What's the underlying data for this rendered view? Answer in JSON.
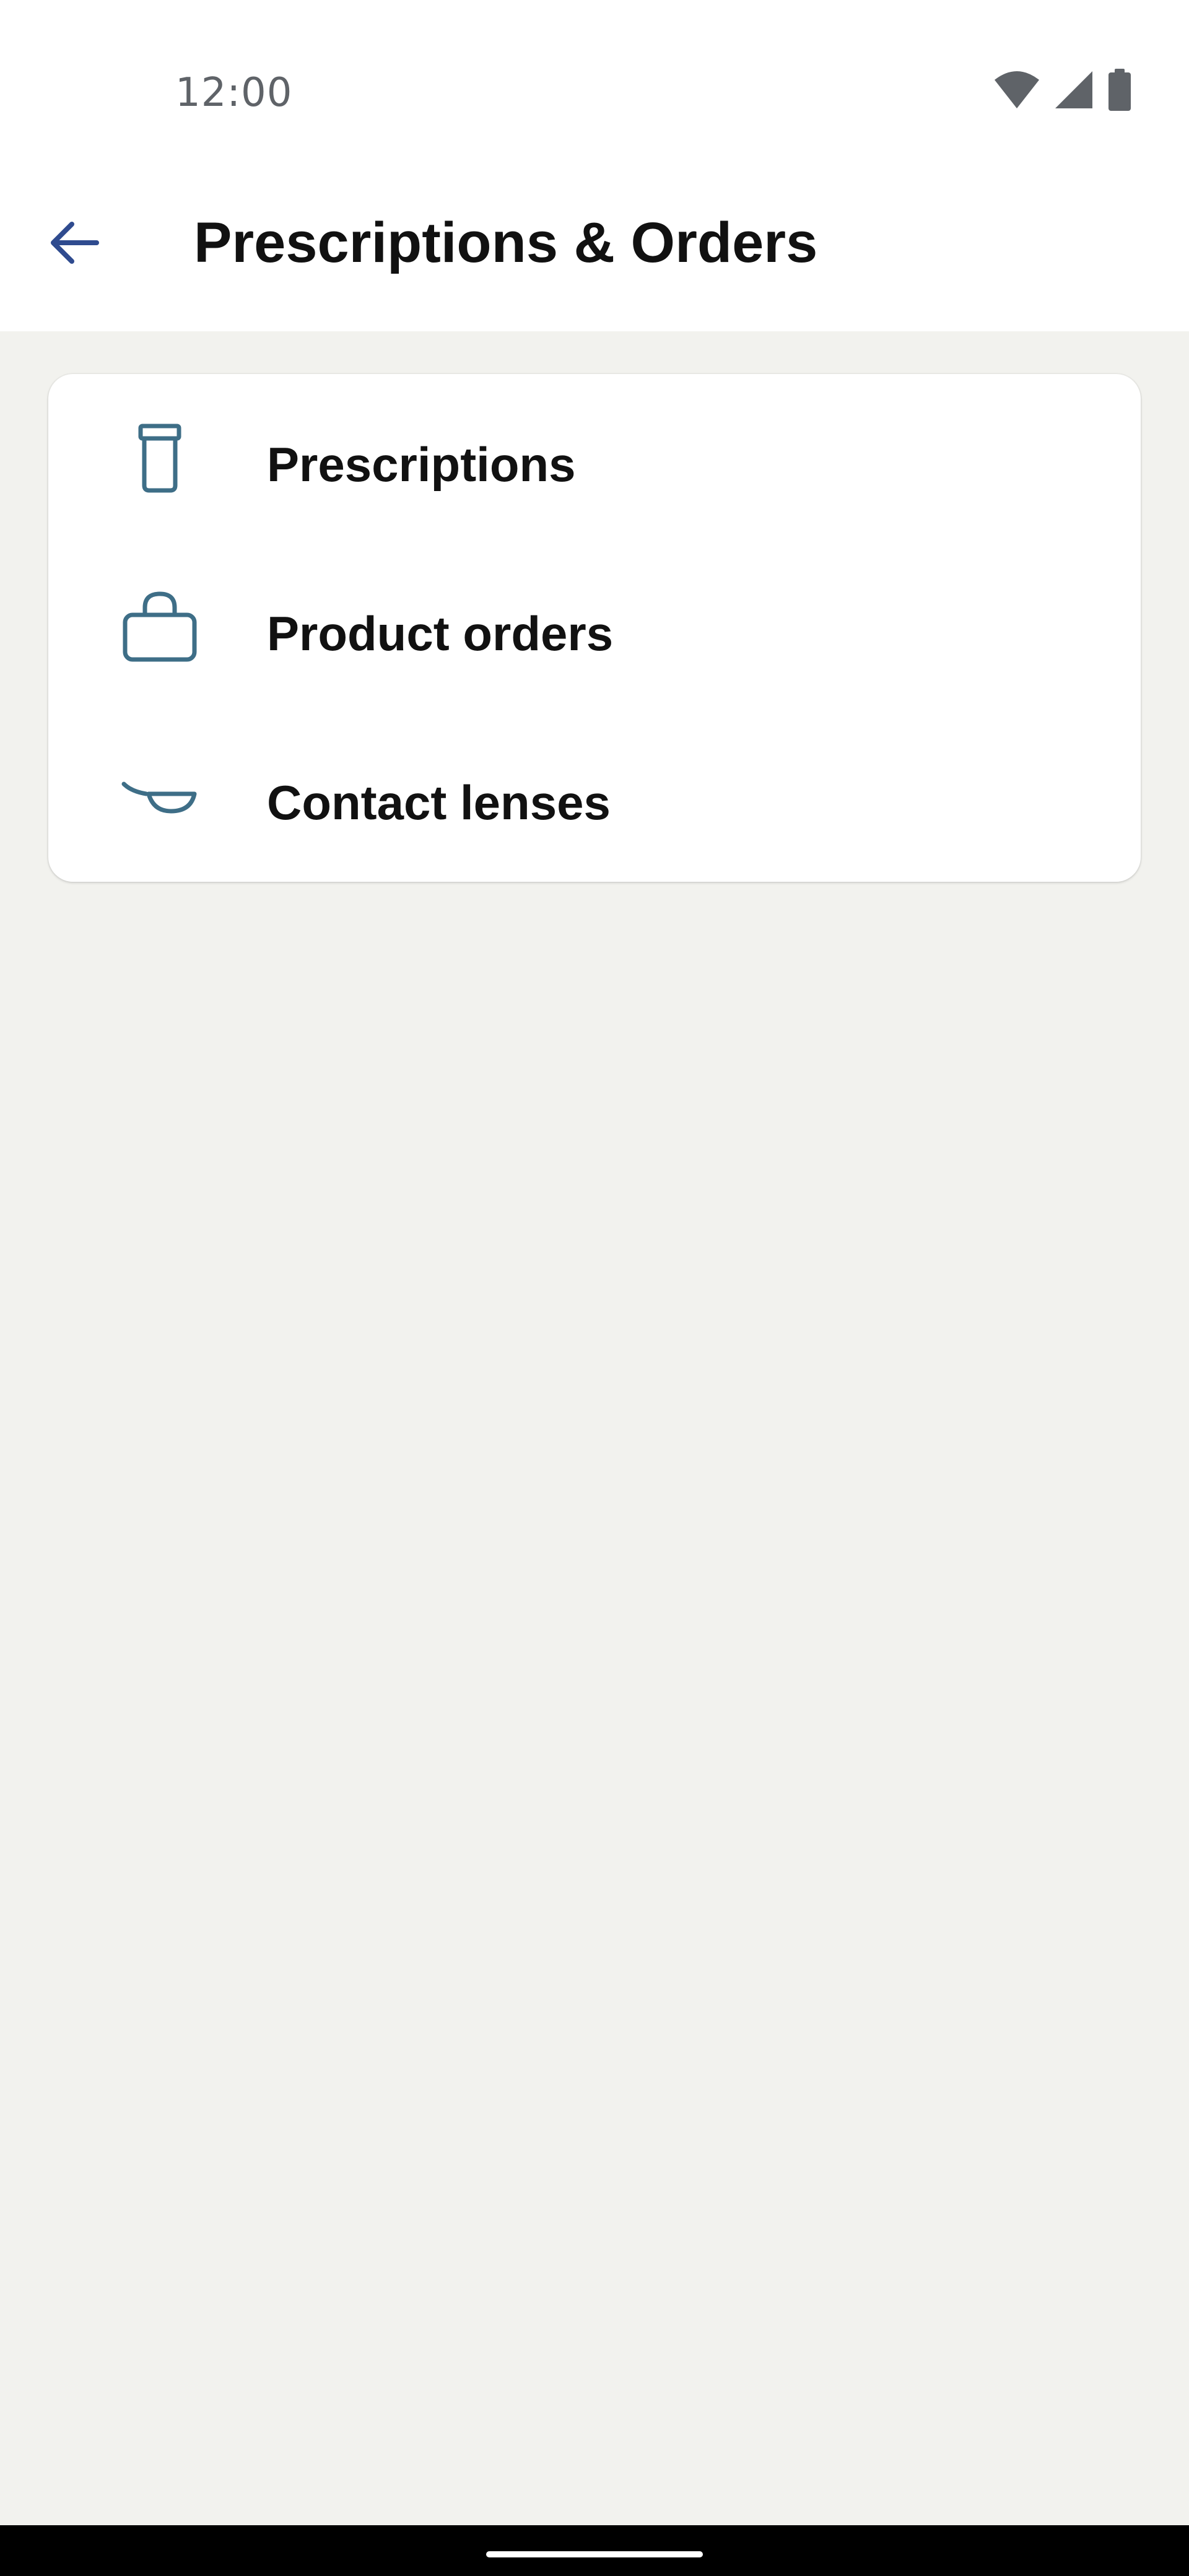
{
  "status_bar": {
    "time": "12:00",
    "icons": [
      "wifi-icon",
      "cellular-signal-icon",
      "battery-icon"
    ]
  },
  "app_bar": {
    "back_icon": "arrow-left-icon",
    "title": "Prescriptions & Orders"
  },
  "menu": {
    "items": [
      {
        "label": "Prescriptions",
        "icon": "pill-bottle-icon"
      },
      {
        "label": "Product orders",
        "icon": "shopping-bag-icon"
      },
      {
        "label": "Contact lenses",
        "icon": "contact-lenses-icon"
      }
    ]
  },
  "colors": {
    "background": "#F2F2EE",
    "surface": "#FFFFFF",
    "accent": "#2F4B8F",
    "icon": "#3E6E87",
    "text": "#111111",
    "status_text": "#5F6368"
  }
}
